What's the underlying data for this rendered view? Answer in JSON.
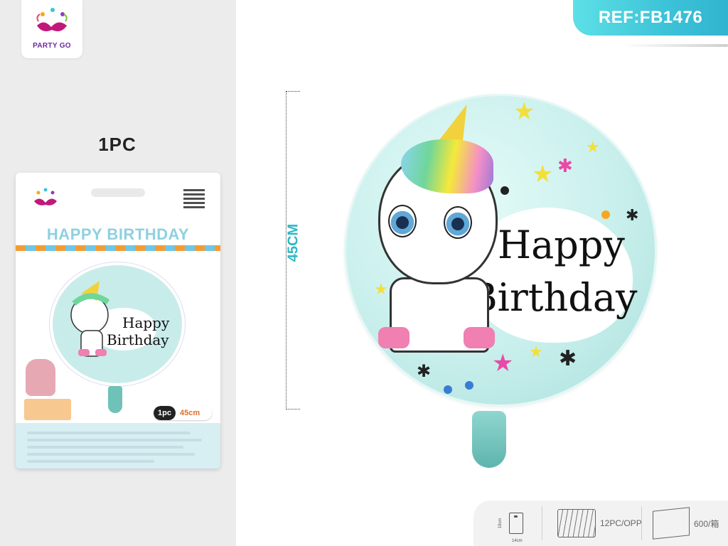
{
  "brand": {
    "name": "PARTY GO"
  },
  "left": {
    "quantity_label": "1PC"
  },
  "package": {
    "title": "HAPPY BIRTHDAY",
    "brand": "PARTY GO",
    "badge_qty": "1pc",
    "badge_size": "45cm"
  },
  "measure": {
    "label": "45CM"
  },
  "ref": {
    "label": "REF:FB1476"
  },
  "balloon": {
    "line1": "Happy",
    "line2": "Birthday"
  },
  "specs": {
    "bag_height": "19cm",
    "bag_width": "14cm",
    "pack": "12PC/OPP",
    "carton": "600/箱"
  },
  "colors": {
    "accent": "#3cc3d8",
    "balloon": "#c8efec",
    "horn": "#f2d23c",
    "hoof": "#f07fb2"
  }
}
